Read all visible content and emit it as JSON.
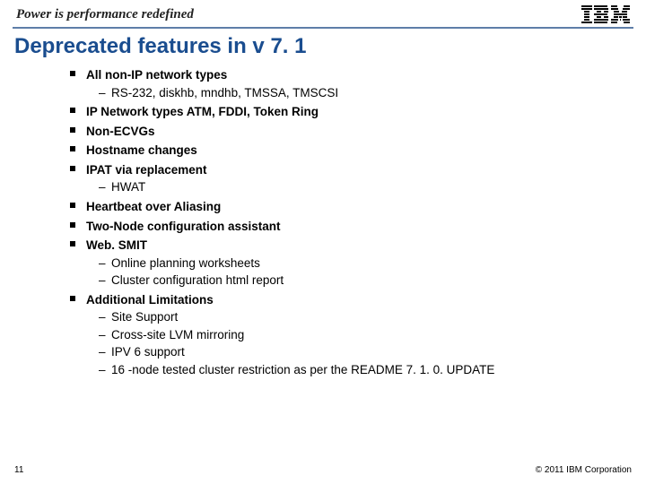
{
  "header": {
    "tagline": "Power is performance redefined",
    "logo_alt": "IBM"
  },
  "title": "Deprecated features in v 7. 1",
  "bullets": [
    {
      "text": "All non-IP network types",
      "sub": [
        "RS-232, diskhb, mndhb, TMSSA, TMSCSI"
      ]
    },
    {
      "text": "IP Network types ATM, FDDI, Token Ring"
    },
    {
      "text": "Non-ECVGs"
    },
    {
      "text": "Hostname changes"
    },
    {
      "text": "IPAT via replacement",
      "sub": [
        "HWAT"
      ]
    },
    {
      "text": "Heartbeat over Aliasing"
    },
    {
      "text": "Two-Node configuration assistant"
    },
    {
      "text": "Web. SMIT",
      "sub": [
        "Online planning worksheets",
        "Cluster configuration html report"
      ]
    },
    {
      "text": "Additional Limitations",
      "sub": [
        "Site Support",
        "Cross-site LVM mirroring",
        "IPV 6 support",
        "16 -node tested cluster restriction as per the README 7. 1. 0. UPDATE"
      ]
    }
  ],
  "footer": {
    "page": "11",
    "copyright": "© 2011 IBM Corporation"
  }
}
